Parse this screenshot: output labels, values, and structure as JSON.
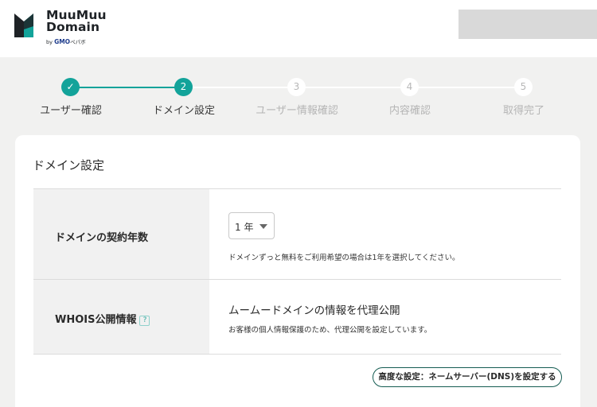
{
  "brand": {
    "line1": "MuuMuu",
    "line2": "Domain",
    "by": "by",
    "gmo": "GMO",
    "pepabo": "ペパボ",
    "mark_color": "#1e2226",
    "accent_color": "#13a39a"
  },
  "steps": [
    {
      "label": "ユーザー確認",
      "number": "✓",
      "state": "done"
    },
    {
      "label": "ドメイン設定",
      "number": "2",
      "state": "active"
    },
    {
      "label": "ユーザー情報確認",
      "number": "3",
      "state": "pending"
    },
    {
      "label": "内容確認",
      "number": "4",
      "state": "pending"
    },
    {
      "label": "取得完了",
      "number": "5",
      "state": "pending"
    }
  ],
  "card": {
    "title": "ドメイン設定",
    "contract": {
      "label": "ドメインの契約年数",
      "selected": "1 年",
      "help": "ドメインずっと無料をご利用希望の場合は1年を選択してください。"
    },
    "whois": {
      "label": "WHOIS公開情報",
      "help_icon": "?",
      "value": "ムームードメインの情報を代理公開",
      "description": "お客様の個人情報保護のため、代理公開を設定しています。"
    },
    "dns_button": "高度な設定：ネームサーバー(DNS)を設定する"
  }
}
